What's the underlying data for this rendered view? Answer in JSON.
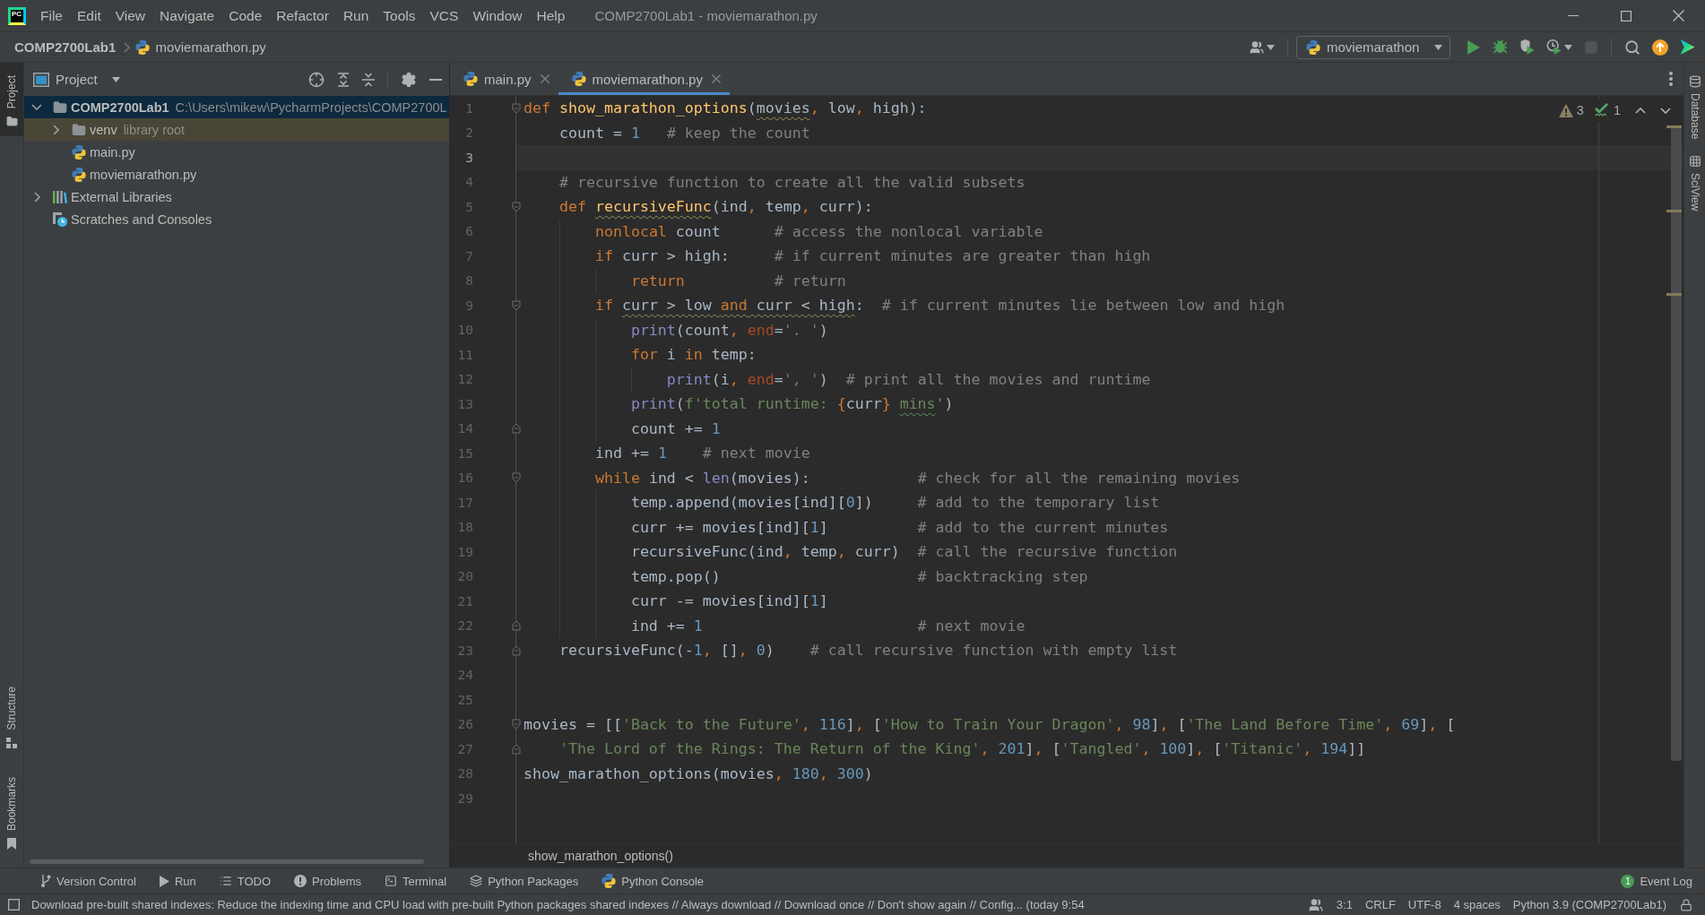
{
  "title_bar": {
    "logo": "PC",
    "menu": [
      "File",
      "Edit",
      "View",
      "Navigate",
      "Code",
      "Refactor",
      "Run",
      "Tools",
      "VCS",
      "Window",
      "Help"
    ],
    "title": "COMP2700Lab1 - moviemarathon.py"
  },
  "nav_bar": {
    "breadcrumbs": [
      {
        "label": "COMP2700Lab1",
        "kind": "project"
      },
      {
        "label": "moviemarathon.py",
        "kind": "file"
      }
    ],
    "run_configuration": "moviemarathon",
    "actions": [
      {
        "kind": "run",
        "disabled": false
      },
      {
        "kind": "debug",
        "disabled": false
      },
      {
        "kind": "coverage",
        "disabled": false
      },
      {
        "kind": "profile",
        "disabled": false
      },
      {
        "kind": "stop",
        "disabled": true
      },
      {
        "kind": "search",
        "disabled": false
      },
      {
        "kind": "update",
        "disabled": false
      },
      {
        "kind": "toolbox",
        "disabled": false
      }
    ]
  },
  "left_strip": {
    "top": [
      {
        "label": "Project",
        "kind": "project",
        "selected": true
      }
    ],
    "bottom": [
      {
        "label": "Structure",
        "kind": "structure",
        "selected": false
      },
      {
        "label": "Bookmarks",
        "kind": "bookmarks",
        "selected": false
      }
    ]
  },
  "project_panel": {
    "title": "Project",
    "tree": [
      {
        "label": "COMP2700Lab1",
        "note": "C:\\Users\\mikew\\PycharmProjects\\COMP2700L",
        "kind": "module",
        "expanded": true,
        "selected": true,
        "highlighted": false,
        "children": [
          {
            "label": "venv",
            "note": "library root",
            "kind": "folder",
            "expanded": false,
            "selected": false,
            "highlighted": true
          },
          {
            "label": "main.py",
            "kind": "python",
            "selected": false,
            "highlighted": false
          },
          {
            "label": "moviemarathon.py",
            "kind": "python",
            "selected": false,
            "highlighted": false
          }
        ]
      },
      {
        "label": "External Libraries",
        "kind": "libraries",
        "expanded": false,
        "selected": false,
        "highlighted": false
      },
      {
        "label": "Scratches and Consoles",
        "kind": "scratches",
        "selected": false,
        "highlighted": false
      }
    ]
  },
  "editor": {
    "tabs": [
      {
        "label": "main.py",
        "selected": false
      },
      {
        "label": "moviemarathon.py",
        "selected": true
      }
    ],
    "inspections": [
      {
        "kind": "warning",
        "count": "3"
      },
      {
        "kind": "typo",
        "count": "1"
      }
    ],
    "lines": [
      {
        "number": "1",
        "kind": "fold_start",
        "current": false,
        "tokens": [
          {
            "kind": "keyword",
            "text": "def "
          },
          {
            "kind": "function",
            "text": "show_marathon_options"
          },
          {
            "kind": "text",
            "text": "("
          },
          {
            "kind": "flagged_text",
            "text": "movies"
          },
          {
            "kind": "punct",
            "text": ", "
          },
          {
            "kind": "text",
            "text": "low"
          },
          {
            "kind": "punct",
            "text": ", "
          },
          {
            "kind": "text",
            "text": "high):"
          }
        ]
      },
      {
        "number": "2",
        "kind": "plain",
        "current": false,
        "tokens": [
          {
            "kind": "text",
            "text": "    count = "
          },
          {
            "kind": "number",
            "text": "1"
          },
          {
            "kind": "comment",
            "text": "   # keep the count"
          }
        ]
      },
      {
        "number": "3",
        "kind": "plain",
        "current": true
      },
      {
        "number": "4",
        "kind": "plain",
        "current": false,
        "tokens": [
          {
            "kind": "comment",
            "text": "    # recursive function to create all the valid subsets"
          }
        ]
      },
      {
        "number": "5",
        "kind": "fold_start",
        "current": false,
        "tokens": [
          {
            "kind": "keyword",
            "text": "    def "
          },
          {
            "kind": "flagged_function",
            "text": "recursiveFunc"
          },
          {
            "kind": "text",
            "text": "(ind"
          },
          {
            "kind": "punct",
            "text": ", "
          },
          {
            "kind": "text",
            "text": "temp"
          },
          {
            "kind": "punct",
            "text": ", "
          },
          {
            "kind": "text",
            "text": "curr):"
          }
        ]
      },
      {
        "number": "6",
        "kind": "plain",
        "current": false,
        "tokens": [
          {
            "kind": "keyword",
            "text": "        nonlocal "
          },
          {
            "kind": "text",
            "text": "count"
          },
          {
            "kind": "comment",
            "text": "      # access the nonlocal variable"
          }
        ]
      },
      {
        "number": "7",
        "kind": "plain",
        "current": false,
        "tokens": [
          {
            "kind": "keyword",
            "text": "        if "
          },
          {
            "kind": "text",
            "text": "curr > high:"
          },
          {
            "kind": "comment",
            "text": "     # if current minutes are greater than high"
          }
        ]
      },
      {
        "number": "8",
        "kind": "plain",
        "current": false,
        "tokens": [
          {
            "kind": "keyword",
            "text": "            return"
          },
          {
            "kind": "comment",
            "text": "          # return"
          }
        ]
      },
      {
        "number": "9",
        "kind": "fold_start",
        "current": false,
        "tokens": [
          {
            "kind": "keyword",
            "text": "        if "
          },
          {
            "kind": "flagged_text",
            "text": "curr > low "
          },
          {
            "kind": "flagged_keyword",
            "text": "and"
          },
          {
            "kind": "flagged_text",
            "text": " curr < high"
          },
          {
            "kind": "text",
            "text": ":"
          },
          {
            "kind": "comment",
            "text": "  # if current minutes lie between low and high"
          }
        ]
      },
      {
        "number": "10",
        "kind": "plain",
        "current": false,
        "tokens": [
          {
            "kind": "builtin",
            "text": "            print"
          },
          {
            "kind": "text",
            "text": "(count"
          },
          {
            "kind": "punct",
            "text": ", "
          },
          {
            "kind": "argument",
            "text": "end"
          },
          {
            "kind": "text",
            "text": "="
          },
          {
            "kind": "string",
            "text": "'. '"
          },
          {
            "kind": "text",
            "text": ")"
          }
        ]
      },
      {
        "number": "11",
        "kind": "plain",
        "current": false,
        "tokens": [
          {
            "kind": "keyword",
            "text": "            for "
          },
          {
            "kind": "text",
            "text": "i "
          },
          {
            "kind": "keyword",
            "text": "in "
          },
          {
            "kind": "text",
            "text": "temp:"
          }
        ]
      },
      {
        "number": "12",
        "kind": "plain",
        "current": false,
        "tokens": [
          {
            "kind": "builtin",
            "text": "                print"
          },
          {
            "kind": "text",
            "text": "(i"
          },
          {
            "kind": "punct",
            "text": ", "
          },
          {
            "kind": "argument",
            "text": "end"
          },
          {
            "kind": "text",
            "text": "="
          },
          {
            "kind": "string",
            "text": "', '"
          },
          {
            "kind": "text",
            "text": ")"
          },
          {
            "kind": "comment",
            "text": "  # print all the movies and runtime"
          }
        ]
      },
      {
        "number": "13",
        "kind": "plain",
        "current": false,
        "tokens": [
          {
            "kind": "builtin",
            "text": "            print"
          },
          {
            "kind": "text",
            "text": "("
          },
          {
            "kind": "string",
            "text": "f'total runtime: "
          },
          {
            "kind": "punct",
            "text": "{"
          },
          {
            "kind": "text",
            "text": "curr"
          },
          {
            "kind": "punct",
            "text": "} "
          },
          {
            "kind": "misspelled_string",
            "text": "mins"
          },
          {
            "kind": "string",
            "text": "'"
          },
          {
            "kind": "text",
            "text": ")"
          }
        ]
      },
      {
        "number": "14",
        "kind": "fold_end",
        "current": false,
        "tokens": [
          {
            "kind": "text",
            "text": "            count += "
          },
          {
            "kind": "number",
            "text": "1"
          }
        ]
      },
      {
        "number": "15",
        "kind": "plain",
        "current": false,
        "tokens": [
          {
            "kind": "text",
            "text": "        ind += "
          },
          {
            "kind": "number",
            "text": "1"
          },
          {
            "kind": "comment",
            "text": "    # next movie"
          }
        ]
      },
      {
        "number": "16",
        "kind": "fold_start",
        "current": false,
        "tokens": [
          {
            "kind": "keyword",
            "text": "        while "
          },
          {
            "kind": "text",
            "text": "ind < "
          },
          {
            "kind": "builtin",
            "text": "len"
          },
          {
            "kind": "text",
            "text": "(movies):"
          },
          {
            "kind": "comment",
            "text": "            # check for all the remaining movies"
          }
        ]
      },
      {
        "number": "17",
        "kind": "plain",
        "current": false,
        "tokens": [
          {
            "kind": "text",
            "text": "            temp.append(movies[ind]["
          },
          {
            "kind": "number",
            "text": "0"
          },
          {
            "kind": "text",
            "text": "])"
          },
          {
            "kind": "comment",
            "text": "     # add to the temporary list"
          }
        ]
      },
      {
        "number": "18",
        "kind": "plain",
        "current": false,
        "tokens": [
          {
            "kind": "text",
            "text": "            curr += movies[ind]["
          },
          {
            "kind": "number",
            "text": "1"
          },
          {
            "kind": "text",
            "text": "]"
          },
          {
            "kind": "comment",
            "text": "          # add to the current minutes"
          }
        ]
      },
      {
        "number": "19",
        "kind": "plain",
        "current": false,
        "tokens": [
          {
            "kind": "text",
            "text": "            recursiveFunc(ind"
          },
          {
            "kind": "punct",
            "text": ", "
          },
          {
            "kind": "text",
            "text": "temp"
          },
          {
            "kind": "punct",
            "text": ", "
          },
          {
            "kind": "text",
            "text": "curr)"
          },
          {
            "kind": "comment",
            "text": "  # call the recursive function"
          }
        ]
      },
      {
        "number": "20",
        "kind": "plain",
        "current": false,
        "tokens": [
          {
            "kind": "text",
            "text": "            temp.pop()"
          },
          {
            "kind": "comment",
            "text": "                      # backtracking step"
          }
        ]
      },
      {
        "number": "21",
        "kind": "plain",
        "current": false,
        "tokens": [
          {
            "kind": "text",
            "text": "            curr -= movies[ind]["
          },
          {
            "kind": "number",
            "text": "1"
          },
          {
            "kind": "text",
            "text": "]"
          }
        ]
      },
      {
        "number": "22",
        "kind": "fold_end",
        "current": false,
        "tokens": [
          {
            "kind": "text",
            "text": "            ind += "
          },
          {
            "kind": "number",
            "text": "1"
          },
          {
            "kind": "comment",
            "text": "                        # next movie"
          }
        ]
      },
      {
        "number": "23",
        "kind": "fold_end",
        "current": false,
        "tokens": [
          {
            "kind": "text",
            "text": "    recursiveFunc(-"
          },
          {
            "kind": "number",
            "text": "1"
          },
          {
            "kind": "punct",
            "text": ", "
          },
          {
            "kind": "text",
            "text": "[]"
          },
          {
            "kind": "punct",
            "text": ", "
          },
          {
            "kind": "number",
            "text": "0"
          },
          {
            "kind": "text",
            "text": ")"
          },
          {
            "kind": "comment",
            "text": "    # call recursive function with empty list"
          }
        ]
      },
      {
        "number": "24",
        "kind": "plain",
        "current": false
      },
      {
        "number": "25",
        "kind": "plain",
        "current": false
      },
      {
        "number": "26",
        "kind": "fold_start",
        "current": false,
        "tokens": [
          {
            "kind": "text",
            "text": "movies = [["
          },
          {
            "kind": "string",
            "text": "'Back to the Future'"
          },
          {
            "kind": "punct",
            "text": ", "
          },
          {
            "kind": "number",
            "text": "116"
          },
          {
            "kind": "text",
            "text": "]"
          },
          {
            "kind": "punct",
            "text": ", "
          },
          {
            "kind": "text",
            "text": "["
          },
          {
            "kind": "string",
            "text": "'How to Train Your Dragon'"
          },
          {
            "kind": "punct",
            "text": ", "
          },
          {
            "kind": "number",
            "text": "98"
          },
          {
            "kind": "text",
            "text": "]"
          },
          {
            "kind": "punct",
            "text": ", "
          },
          {
            "kind": "text",
            "text": "["
          },
          {
            "kind": "string",
            "text": "'The Land Before Time'"
          },
          {
            "kind": "punct",
            "text": ", "
          },
          {
            "kind": "number",
            "text": "69"
          },
          {
            "kind": "text",
            "text": "]"
          },
          {
            "kind": "punct",
            "text": ", "
          },
          {
            "kind": "text",
            "text": "["
          }
        ]
      },
      {
        "number": "27",
        "kind": "fold_end",
        "current": false,
        "tokens": [
          {
            "kind": "string",
            "text": "    'The Lord of the Rings: The Return of the King'"
          },
          {
            "kind": "punct",
            "text": ", "
          },
          {
            "kind": "number",
            "text": "201"
          },
          {
            "kind": "text",
            "text": "]"
          },
          {
            "kind": "punct",
            "text": ", "
          },
          {
            "kind": "text",
            "text": "["
          },
          {
            "kind": "string",
            "text": "'Tangled'"
          },
          {
            "kind": "punct",
            "text": ", "
          },
          {
            "kind": "number",
            "text": "100"
          },
          {
            "kind": "text",
            "text": "]"
          },
          {
            "kind": "punct",
            "text": ", "
          },
          {
            "kind": "text",
            "text": "["
          },
          {
            "kind": "string",
            "text": "'Titanic'"
          },
          {
            "kind": "punct",
            "text": ", "
          },
          {
            "kind": "number",
            "text": "194"
          },
          {
            "kind": "text",
            "text": "]]"
          }
        ]
      },
      {
        "number": "28",
        "kind": "plain",
        "current": false,
        "tokens": [
          {
            "kind": "text",
            "text": "show_marathon_options(movies"
          },
          {
            "kind": "punct",
            "text": ", "
          },
          {
            "kind": "number",
            "text": "180"
          },
          {
            "kind": "punct",
            "text": ", "
          },
          {
            "kind": "number",
            "text": "300"
          },
          {
            "kind": "text",
            "text": ")"
          }
        ]
      },
      {
        "number": "29",
        "kind": "plain",
        "current": false
      }
    ],
    "breadcrumb": "show_marathon_options()"
  },
  "right_strip": [
    {
      "label": "Database",
      "kind": "database"
    },
    {
      "label": "SciView",
      "kind": "sciview"
    }
  ],
  "tool_windows": [
    {
      "label": "Version Control",
      "kind": "vcs"
    },
    {
      "label": "Run",
      "kind": "run"
    },
    {
      "label": "TODO",
      "kind": "todo"
    },
    {
      "label": "Problems",
      "kind": "problems"
    },
    {
      "label": "Terminal",
      "kind": "terminal"
    },
    {
      "label": "Python Packages",
      "kind": "packages"
    },
    {
      "label": "Python Console",
      "kind": "console"
    }
  ],
  "event_log": {
    "label": "Event Log",
    "count": "1"
  },
  "status_bar": {
    "message": "Download pre-built shared indexes: Reduce the indexing time and CPU load with pre-built Python packages shared indexes // Always download // Download once // Don't show again // Config... (today 9:54",
    "items": [
      "3:1",
      "CRLF",
      "UTF-8",
      "4 spaces",
      "Python 3.9 (COMP2700Lab1)"
    ]
  }
}
